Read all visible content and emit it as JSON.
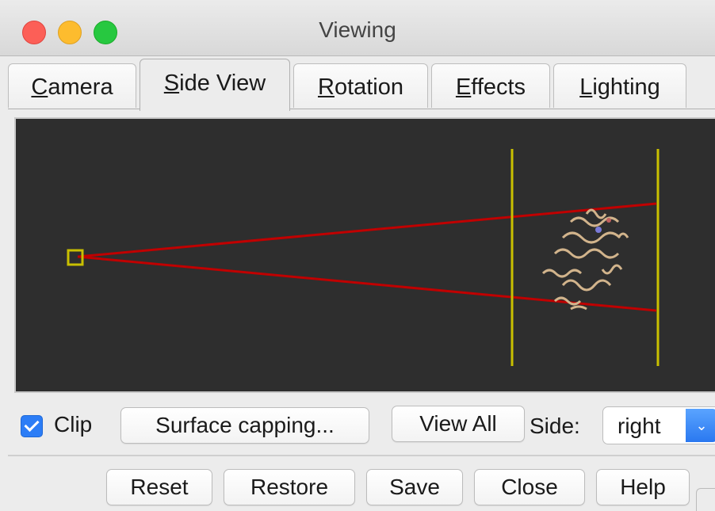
{
  "window": {
    "title": "Viewing"
  },
  "tabs": [
    {
      "mnemonic": "C",
      "rest": "amera",
      "active": false
    },
    {
      "mnemonic": "S",
      "rest": "ide View",
      "active": true
    },
    {
      "mnemonic": "R",
      "rest": "otation",
      "active": false
    },
    {
      "mnemonic": "E",
      "rest": "ffects",
      "active": false
    },
    {
      "mnemonic": "L",
      "rest": "ighting",
      "active": false
    }
  ],
  "controls": {
    "clip_label": "Clip",
    "clip_checked": true,
    "surface_capping_label": "Surface capping...",
    "view_all_label": "View All",
    "side_label": "Side:",
    "side_value": "right"
  },
  "buttons": {
    "reset": "Reset",
    "restore": "Restore",
    "save": "Save",
    "close": "Close",
    "help": "Help"
  },
  "colors": {
    "canvas_bg": "#2e2e2e",
    "clip_plane": "#c9c000",
    "view_frustum": "#c00000",
    "molecule": "#d2b48c",
    "accent": "#2c7df6"
  }
}
